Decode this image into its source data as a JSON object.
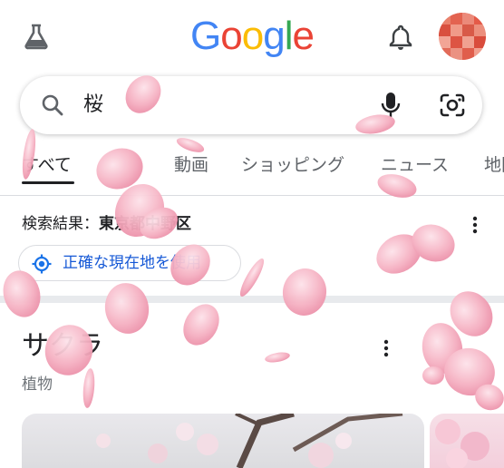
{
  "header": {
    "labs_icon": "labs-flask-icon",
    "logo_letters": [
      {
        "ch": "G",
        "color": "#4285F4"
      },
      {
        "ch": "o",
        "color": "#EA4335"
      },
      {
        "ch": "o",
        "color": "#FBBC05"
      },
      {
        "ch": "g",
        "color": "#4285F4"
      },
      {
        "ch": "l",
        "color": "#34A853"
      },
      {
        "ch": "e",
        "color": "#EA4335"
      }
    ],
    "notifications_icon": "bell-icon",
    "avatar_icon": "account-avatar"
  },
  "search": {
    "query": "桜",
    "search_icon": "search-icon",
    "voice_icon": "mic-icon",
    "lens_icon": "lens-camera-icon"
  },
  "tabs": [
    {
      "label": "すべて",
      "active": true
    },
    {
      "label": "動画",
      "active": false
    },
    {
      "label": "ショッピング",
      "active": false
    },
    {
      "label": "ニュース",
      "active": false
    },
    {
      "label": "地図",
      "active": false
    }
  ],
  "results": {
    "location_prefix": "検索結果：",
    "location_name": "東京都中野区",
    "precise_location_label": "正確な現在地を使用",
    "more_icon": "more-vert-icon"
  },
  "knowledge_panel": {
    "title": "サクラ",
    "subtitle": "植物",
    "more_icon": "more-vert-icon"
  },
  "colors": {
    "accent_blue": "#1a73e8",
    "link_blue": "#1558d6",
    "petal_pink": "#f5a9bd"
  }
}
